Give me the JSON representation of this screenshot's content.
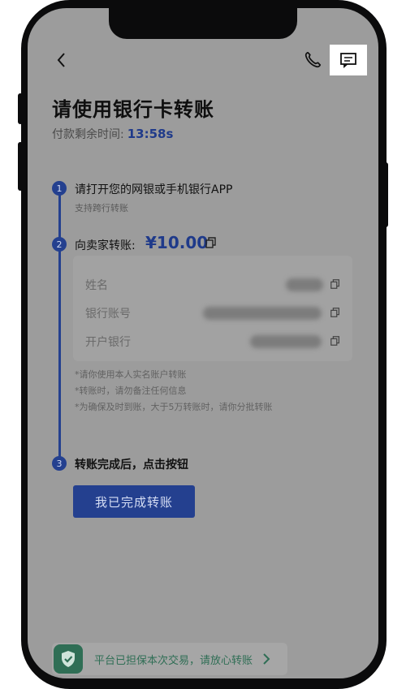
{
  "nav": {
    "back_icon": "chevron-left-icon",
    "phone_icon": "phone-icon",
    "message_icon": "message-icon"
  },
  "page": {
    "title": "请使用银行卡转账",
    "timer_label": "付款剩余时间:",
    "timer_value": "13:58s"
  },
  "steps": [
    {
      "num": "1",
      "text": "请打开您的网银或手机银行APP",
      "sub": "支持跨行转账"
    },
    {
      "num": "2",
      "text": "向卖家转账:",
      "amount": "¥10.00"
    },
    {
      "num": "3",
      "text": "转账完成后，点击按钮"
    }
  ],
  "payee": {
    "fields": [
      {
        "label": "姓名"
      },
      {
        "label": "银行账号"
      },
      {
        "label": "开户银行"
      }
    ]
  },
  "notes": [
    "*请你使用本人实名账户转账",
    "*转账时，请勿备注任何信息",
    "*为确保及时到账，大于5万转账时，请你分批转账"
  ],
  "action": {
    "done_label": "我已完成转账"
  },
  "guarantee": {
    "text": "平台已担保本次交易，请放心转账"
  },
  "colors": {
    "accent": "#24408f",
    "green": "#2f6e55",
    "overlay": "#9c9c9c"
  }
}
